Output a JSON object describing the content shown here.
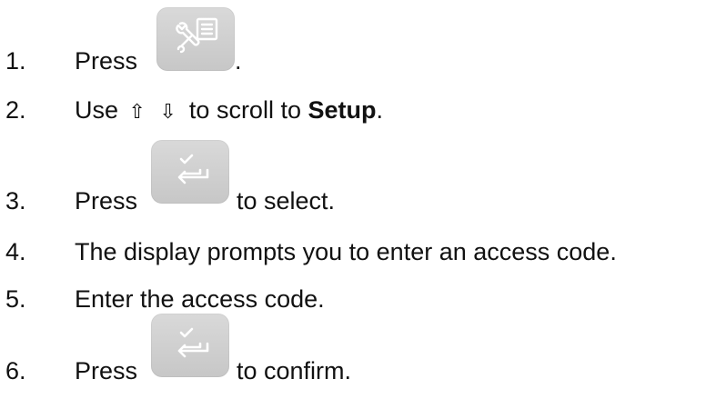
{
  "steps": [
    {
      "number": "1.",
      "before": "Press",
      "button_icon": "wrench-menu-icon",
      "after": "."
    },
    {
      "number": "2.",
      "before": "Use",
      "up_arrow": "⇧",
      "down_arrow": "⇩",
      "middle": "to scroll to",
      "target": "Setup",
      "after": "."
    },
    {
      "number": "3.",
      "before": "Press",
      "button_icon": "enter-confirm-icon",
      "after": "to select."
    },
    {
      "number": "4.",
      "text": "The display prompts you to enter an access code."
    },
    {
      "number": "5.",
      "text": "Enter the access code."
    },
    {
      "number": "6.",
      "before": "Press",
      "button_icon": "enter-confirm-icon",
      "after": "to confirm."
    }
  ]
}
